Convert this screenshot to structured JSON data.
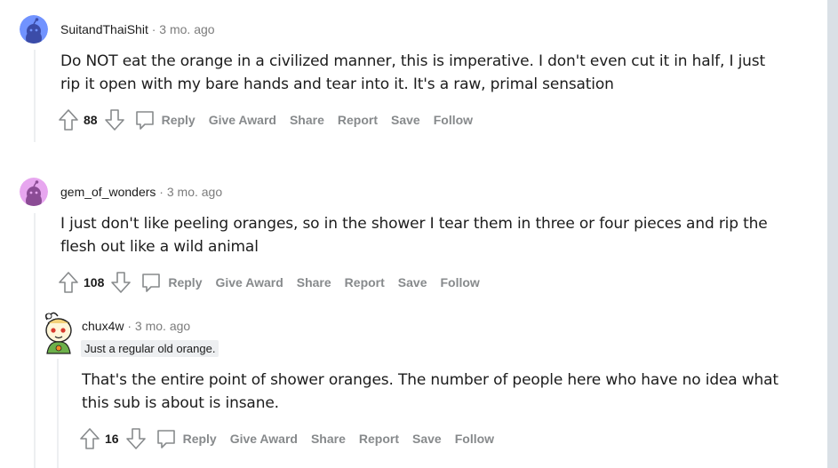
{
  "colors": {
    "page_bg": "#dae0e6",
    "card_bg": "#ffffff",
    "thread_line": "#edeff1",
    "muted_text": "#878a8c",
    "meta_time": "#7c7c7c",
    "avatar_1": "#7193ff",
    "avatar_2": "#c18d42"
  },
  "comments": [
    {
      "author": "SuitandThaiShit",
      "separator": "·",
      "time": "3 mo. ago",
      "avatar_icon": "snoo-avatar-blue-icon",
      "body": "Do NOT eat the orange in a civilized manner, this is imperative. I don't even cut it in half, I just rip it open with my bare hands and tear into it. It's a raw, primal sensation",
      "score": "88",
      "actions": [
        "Reply",
        "Give Award",
        "Share",
        "Report",
        "Save",
        "Follow"
      ]
    },
    {
      "author": "gem_of_wonders",
      "separator": "·",
      "time": "3 mo. ago",
      "avatar_icon": "snoo-avatar-pink-icon",
      "body": "I just don't like peeling oranges, so in the shower I tear them in three or four pieces and rip the flesh out like a wild animal",
      "score": "108",
      "actions": [
        "Reply",
        "Give Award",
        "Share",
        "Report",
        "Save",
        "Follow"
      ]
    },
    {
      "author": "chux4w",
      "separator": "·",
      "time": "3 mo. ago",
      "avatar_icon": "custom-snoo-avatar-icon",
      "flair": "Just a regular old orange.",
      "body": "That's the entire point of shower oranges. The number of people here who have no idea what this sub is about is insane.",
      "score": "16",
      "actions": [
        "Reply",
        "Give Award",
        "Share",
        "Report",
        "Save",
        "Follow"
      ]
    }
  ]
}
